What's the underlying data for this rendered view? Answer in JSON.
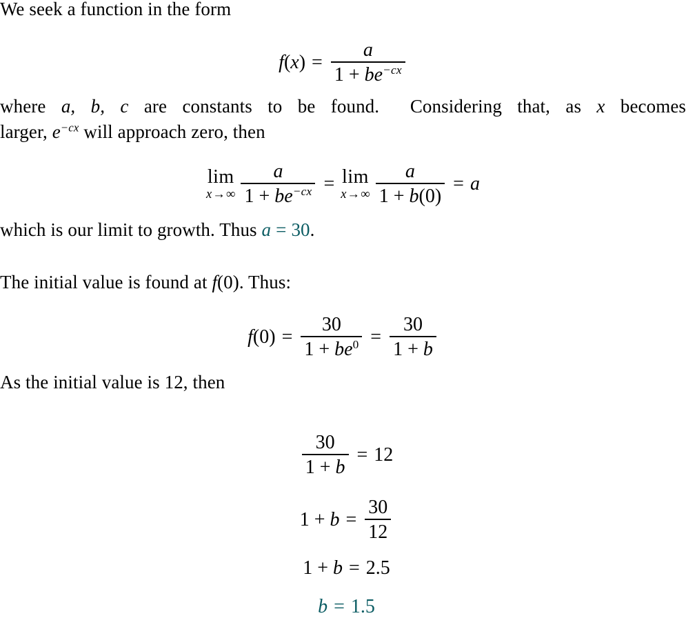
{
  "document": {
    "type": "math-derivation",
    "accent_color": "#0b5c63",
    "text_color": "#000000",
    "background_color": "#ffffff"
  },
  "paragraph_1": {
    "line_1": "We seek a function in the form"
  },
  "equation_1": {
    "lhs_f": "f",
    "lhs_open": "(",
    "lhs_var": "x",
    "lhs_close": ")",
    "equals": "=",
    "numerator": "a",
    "den_one": "1",
    "den_plus": "+",
    "den_b": "b",
    "den_e": "e",
    "den_exp": "−cx"
  },
  "paragraph_2": {
    "line_1_part_1": "where ",
    "line_1_constants": "a, b, c",
    "line_1_part_2": " are constants to be found.",
    "line_1_part_3": "Considering that, as ",
    "line_1_var": "x",
    "line_1_part_4": " becomes",
    "line_2_part_1": "larger, ",
    "line_2_e": "e",
    "line_2_exp": "−cx",
    "line_2_part_2": " will approach zero, then"
  },
  "equation_2": {
    "lim_label": "lim",
    "lim_sub_var": "x",
    "lim_sub_arrow": "→",
    "lim_sub_target": "∞",
    "numerator": "a",
    "den1_one": "1",
    "den1_plus": "+",
    "den1_b": "b",
    "den1_e": "e",
    "den1_exp": "−cx",
    "middle_equals": "=",
    "numerator_2": "a",
    "den2_one": "1",
    "den2_plus": "+",
    "den2_b": "b",
    "den2_paren": "(0)",
    "final_equals": "=",
    "result": "a"
  },
  "paragraph_3": {
    "text_before": "which is our limit to growth. Thus ",
    "accent_var": "a",
    "accent_equals": "=",
    "accent_value": "30",
    "text_after": "."
  },
  "paragraph_4": {
    "text_before": "The initial value is found at ",
    "f_symbol": "f",
    "f_arg": "(0)",
    "text_after": ". Thus:"
  },
  "equation_3": {
    "lhs_f": "f",
    "lhs_arg": "(0)",
    "equals_1": "=",
    "num_1": "30",
    "den_one": "1",
    "den_plus": "+",
    "den_b": "b",
    "den_e": "e",
    "den_exp": "0",
    "equals_2": "=",
    "num_2": "30",
    "den2_one": "1",
    "den2_plus": "+",
    "den2_b": "b"
  },
  "paragraph_5": {
    "text": "As the initial value is 12, then"
  },
  "equation_4": {
    "numerator": "30",
    "den_one": "1",
    "den_plus": "+",
    "den_b": "b",
    "equals": "=",
    "rhs": "12"
  },
  "equation_5": {
    "lhs_one": "1",
    "lhs_plus": "+",
    "lhs_b": "b",
    "equals": "=",
    "num": "30",
    "den": "12"
  },
  "equation_6": {
    "lhs_one": "1",
    "lhs_plus": "+",
    "lhs_b": "b",
    "equals": "=",
    "rhs": "2.5"
  },
  "equation_7": {
    "lhs_b": "b",
    "equals": "=",
    "rhs": "1.5"
  }
}
